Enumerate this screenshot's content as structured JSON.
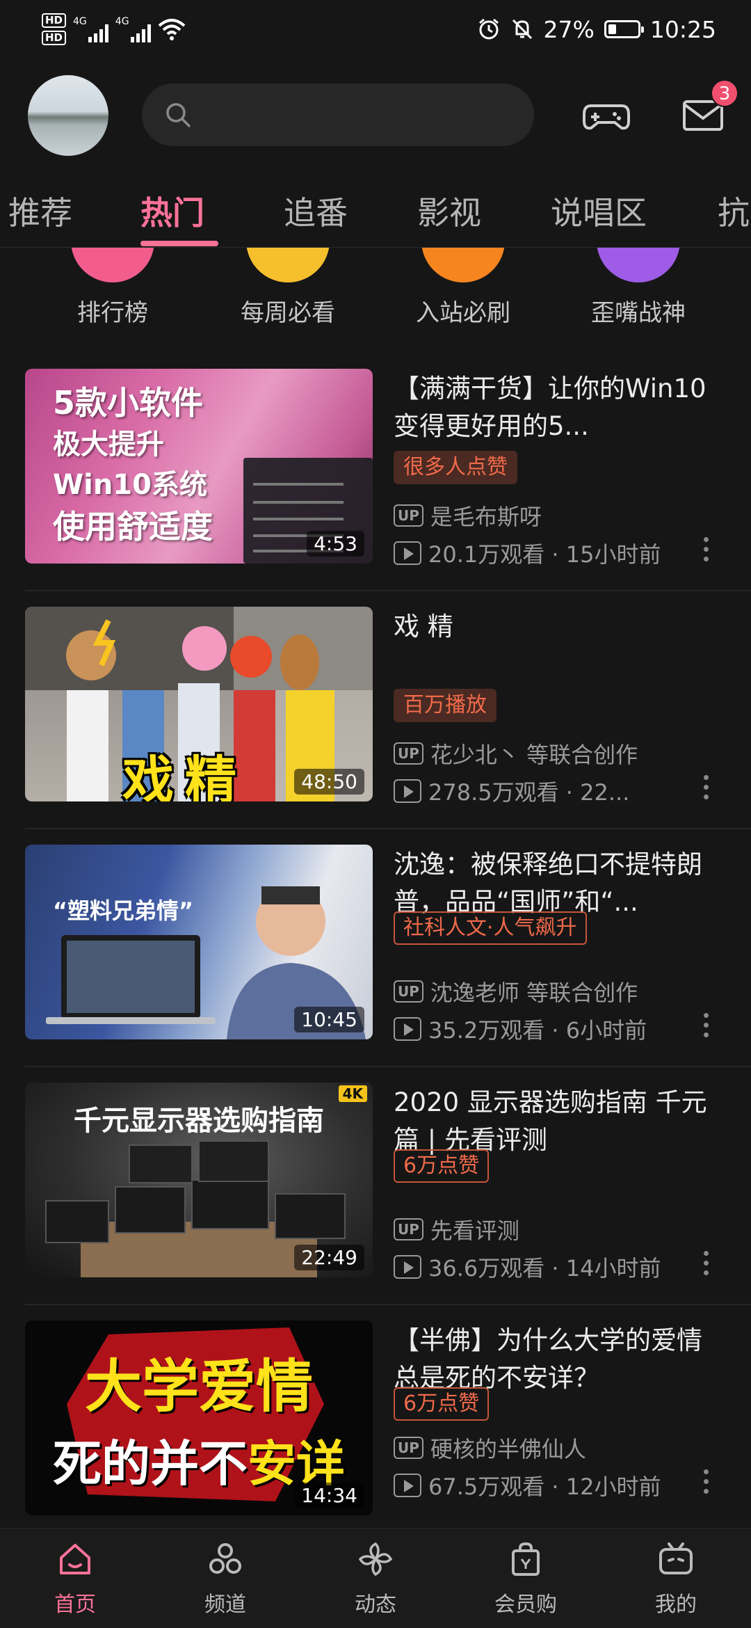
{
  "status_bar": {
    "hd1": "HD",
    "hd2": "HD",
    "network1": "4G",
    "network2": "4G",
    "battery": "27%",
    "battery_level": 0.27,
    "time": "10:25"
  },
  "header": {
    "search_placeholder": "",
    "message_badge": "3"
  },
  "tabs": [
    "推荐",
    "热门",
    "追番",
    "影视",
    "说唱区",
    "抗"
  ],
  "active_tab": "热门",
  "entries": [
    {
      "label": "排行榜",
      "color": "#f25d8e"
    },
    {
      "label": "每周必看",
      "color": "#f6c02d"
    },
    {
      "label": "入站必刷",
      "color": "#f6851f"
    },
    {
      "label": "歪嘴战神",
      "color": "#9f5ce6"
    }
  ],
  "videos": [
    {
      "title": "【满满干货】让你的Win10变得更好用的5...",
      "tag": "很多人点赞",
      "up": "是毛布斯呀",
      "stats": "20.1万观看 · 15小时前",
      "duration": "4:53",
      "thumb_lines": [
        "5款小软件",
        "极大提升",
        "Win10系统",
        "使用舒适度"
      ]
    },
    {
      "title": "戏 精",
      "tag": "百万播放",
      "up": "花少北丶 等联合创作",
      "stats": "278.5万观看 · 22...",
      "duration": "48:50",
      "thumb_text": "戏精"
    },
    {
      "title": "沈逸：被保释绝口不提特朗普，品品“国师”和“...",
      "tag": "社科人文·人气飙升",
      "up": "沈逸老师 等联合创作",
      "stats": "35.2万观看 · 6小时前",
      "duration": "10:45",
      "thumb_text": "“塑料兄弟情”"
    },
    {
      "title": "2020 显示器选购指南 千元篇 | 先看评测",
      "tag": "6万点赞",
      "up": "先看评测",
      "stats": "36.6万观看 · 14小时前",
      "duration": "22:49",
      "thumb_text": "千元显示器选购指南",
      "badge_4k": "4K"
    },
    {
      "title": "【半佛】为什么大学的爱情总是死的不安详？",
      "tag": "6万点赞",
      "up": "硬核的半佛仙人",
      "stats": "67.5万观看 · 12小时前",
      "duration": "14:34",
      "thumb_line1": "大学爱情",
      "thumb_line2a": "死的并不",
      "thumb_line2b": "安详"
    }
  ],
  "bottom_nav": [
    "首页",
    "频道",
    "动态",
    "会员购",
    "我的"
  ],
  "colors": {
    "accent": "#fb7299",
    "tag_text": "#f06a4a"
  }
}
